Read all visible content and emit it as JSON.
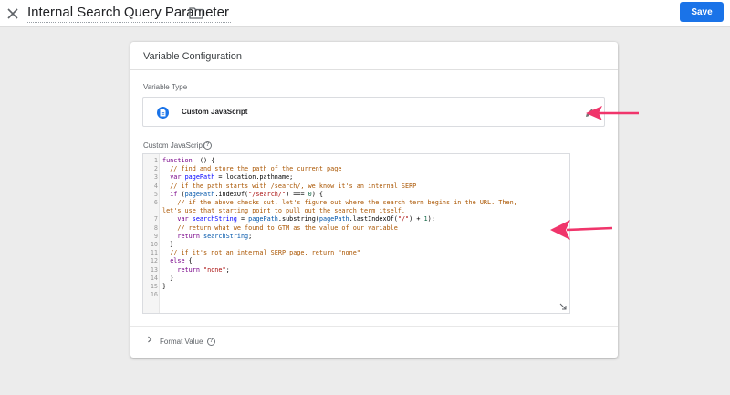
{
  "header": {
    "title": "Internal Search Query Parameter",
    "save_label": "Save",
    "icons": {
      "close": "close-icon",
      "folder": "folder-icon"
    },
    "accent_color": "#1a73e8"
  },
  "card": {
    "title": "Variable Configuration",
    "variable_type": {
      "label": "Variable Type",
      "value": "Custom JavaScript",
      "icon": "document-icon",
      "edit_icon": "pencil-icon"
    },
    "custom_js": {
      "label": "Custom JavaScript",
      "help_glyph": "?",
      "lines": [
        {
          "n": "1",
          "tokens": [
            [
              "kw",
              "function"
            ],
            [
              "",
              "  () {"
            ]
          ]
        },
        {
          "n": "2",
          "tokens": [
            [
              "",
              "  "
            ],
            [
              "cm",
              "// find and store the path of the current page"
            ]
          ]
        },
        {
          "n": "3",
          "tokens": [
            [
              "",
              "  "
            ],
            [
              "kw",
              "var"
            ],
            [
              "",
              " "
            ],
            [
              "df",
              "pagePath"
            ],
            [
              "",
              " = location.pathname;"
            ]
          ]
        },
        {
          "n": "4",
          "tokens": [
            [
              "",
              "  "
            ],
            [
              "cm",
              "// if the path starts with /search/, we know it's an internal SERP"
            ]
          ]
        },
        {
          "n": "5",
          "tokens": [
            [
              "",
              "  "
            ],
            [
              "kw",
              "if"
            ],
            [
              "",
              " ("
            ],
            [
              "vr",
              "pagePath"
            ],
            [
              "",
              ".indexOf("
            ],
            [
              "st",
              "\"/search/\""
            ],
            [
              "",
              ") === "
            ],
            [
              "nm",
              "0"
            ],
            [
              "",
              ") {"
            ]
          ]
        },
        {
          "n": "6",
          "tokens": [
            [
              "",
              "    "
            ],
            [
              "cm",
              "// if the above checks out, let's figure out where the search term begins in the URL. Then,"
            ]
          ]
        },
        {
          "n": "",
          "tokens": [
            [
              "cm",
              "let's use that starting point to pull out the search term itself."
            ]
          ]
        },
        {
          "n": "7",
          "tokens": [
            [
              "",
              "    "
            ],
            [
              "kw",
              "var"
            ],
            [
              "",
              " "
            ],
            [
              "df",
              "searchString"
            ],
            [
              "",
              " = "
            ],
            [
              "vr",
              "pagePath"
            ],
            [
              "",
              ".substring("
            ],
            [
              "vr",
              "pagePath"
            ],
            [
              "",
              ".lastIndexOf("
            ],
            [
              "st",
              "\"/\""
            ],
            [
              "",
              ") + "
            ],
            [
              "nm",
              "1"
            ],
            [
              "",
              ");"
            ]
          ]
        },
        {
          "n": "8",
          "tokens": [
            [
              "",
              "    "
            ],
            [
              "cm",
              "// return what we found to GTM as the value of our variable"
            ]
          ]
        },
        {
          "n": "9",
          "tokens": [
            [
              "",
              "    "
            ],
            [
              "kw",
              "return"
            ],
            [
              "",
              " "
            ],
            [
              "vr",
              "searchString"
            ],
            [
              "",
              ";"
            ]
          ]
        },
        {
          "n": "10",
          "tokens": [
            [
              "",
              "  }"
            ]
          ]
        },
        {
          "n": "11",
          "tokens": [
            [
              "",
              "  "
            ],
            [
              "cm",
              "// if it's not an internal SERP page, return \"none\""
            ]
          ]
        },
        {
          "n": "12",
          "tokens": [
            [
              "",
              "  "
            ],
            [
              "kw",
              "else"
            ],
            [
              "",
              " {"
            ]
          ]
        },
        {
          "n": "13",
          "tokens": [
            [
              "",
              "    "
            ],
            [
              "kw",
              "return"
            ],
            [
              "",
              " "
            ],
            [
              "st",
              "\"none\""
            ],
            [
              "",
              ";"
            ]
          ]
        },
        {
          "n": "14",
          "tokens": [
            [
              "",
              "  }"
            ]
          ]
        },
        {
          "n": "15",
          "tokens": [
            [
              "",
              "}"
            ]
          ]
        },
        {
          "n": "16",
          "tokens": []
        }
      ]
    },
    "format_value": {
      "label": "Format Value",
      "help_glyph": "?"
    }
  },
  "annotations": {
    "arrow_color": "#f0356b"
  }
}
